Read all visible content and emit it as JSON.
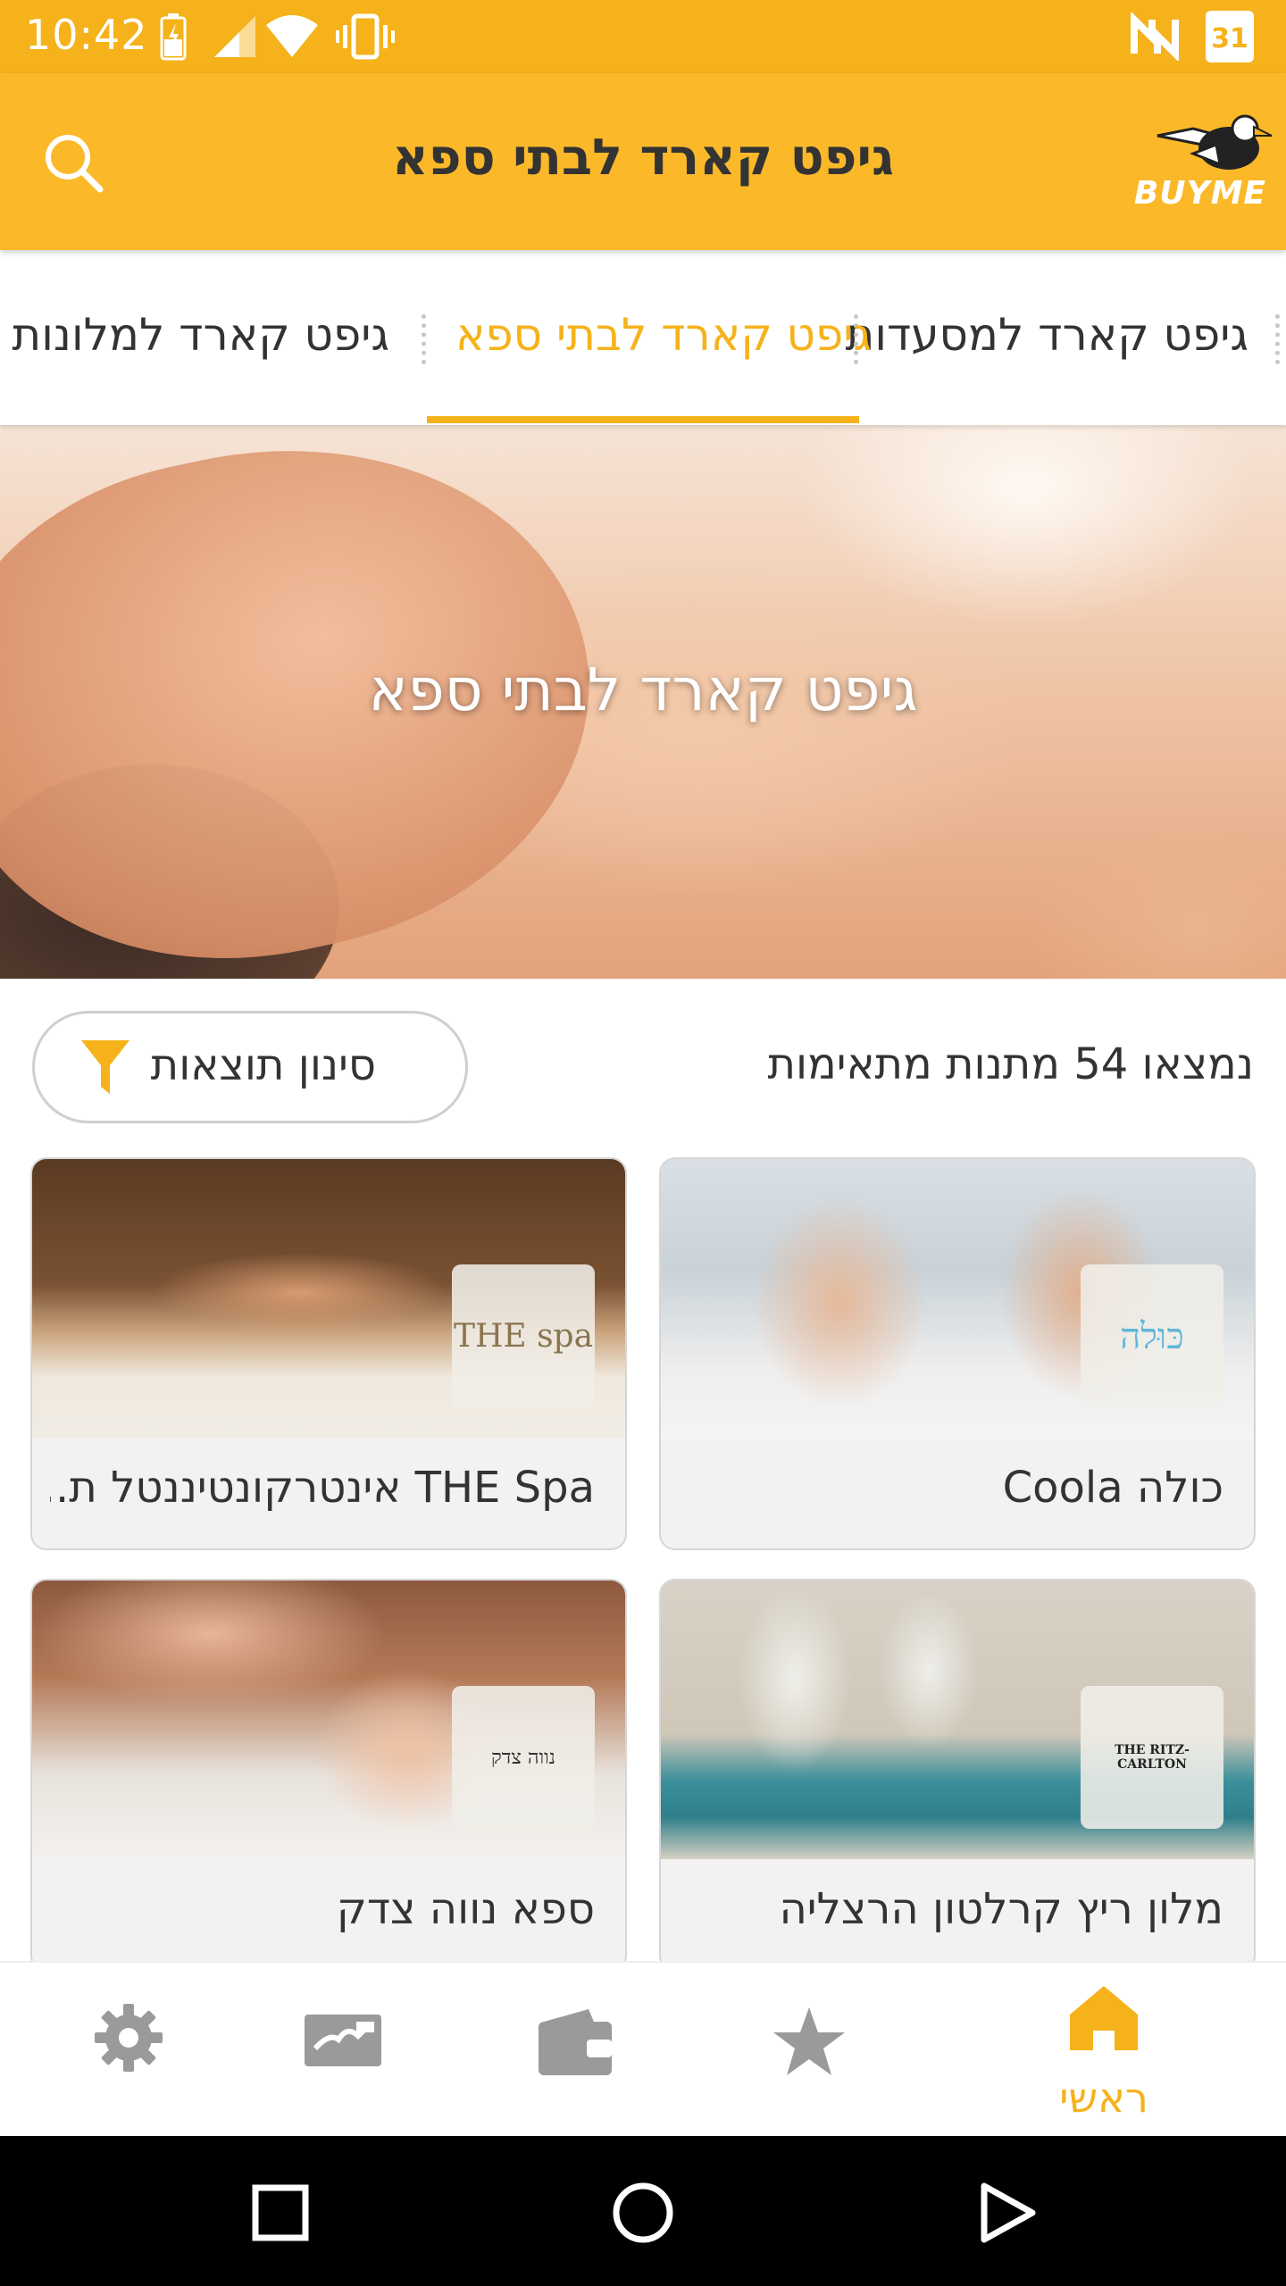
{
  "status_bar": {
    "time": "10:42",
    "calendar_day": "31"
  },
  "app_bar": {
    "title": "גיפט קארד לבתי ספא",
    "logo_text": "BUYME"
  },
  "tabs": [
    {
      "label": "גיפט קארד למסעדות"
    },
    {
      "label": "גיפט קארד לבתי ספא"
    },
    {
      "label": "גיפט קארד למלונות יוקרה"
    }
  ],
  "hero": {
    "title": "גיפט קארד לבתי ספא"
  },
  "results": {
    "count_text": "נמצאו 54 מתנות מתאימות",
    "filter_label": "סינון תוצאות"
  },
  "cards": [
    {
      "title": "כולה Coola",
      "logo_text": "כּוּלה"
    },
    {
      "title": "THE Spa אינטרקונטיננטל ת...",
      "logo_text": "THE spa"
    },
    {
      "title": "מלון ריץ קרלטון הרצליה",
      "logo_text": "THE RITZ-CARLTON"
    },
    {
      "title": "ספא נווה צדק",
      "logo_text": "נווה צדק"
    }
  ],
  "bottom_nav": {
    "home_label": "ראשי"
  },
  "colors": {
    "accent": "#f5b21a",
    "text": "#333333",
    "nav_inactive": "#9a9a9a"
  }
}
